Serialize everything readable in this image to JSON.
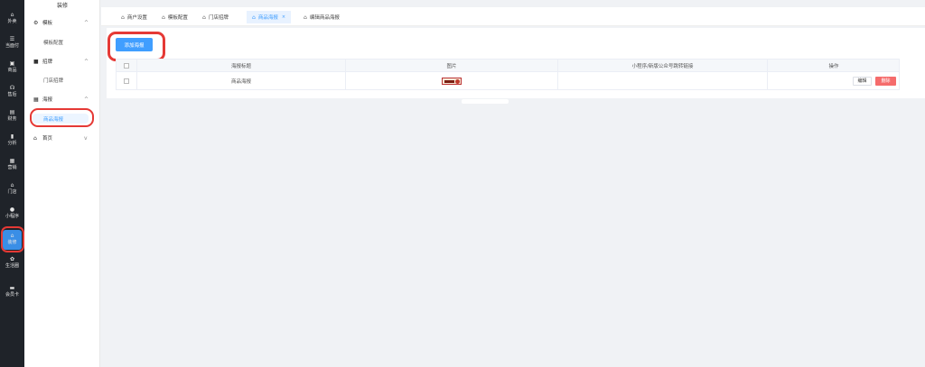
{
  "rail": {
    "items": [
      {
        "icon": "⌂",
        "label": "外卖"
      },
      {
        "icon": "☰",
        "label": "当面付"
      },
      {
        "icon": "▣",
        "label": "商品"
      },
      {
        "icon": "☊",
        "label": "售后"
      },
      {
        "icon": "▤",
        "label": "财务"
      },
      {
        "icon": "▮",
        "label": "分析"
      },
      {
        "icon": "▦",
        "label": "营销"
      },
      {
        "icon": "⌂",
        "label": "门店"
      },
      {
        "icon": "●",
        "label": "小程序"
      },
      {
        "icon": "⌂",
        "label": "装修"
      },
      {
        "icon": "✿",
        "label": "生活圈"
      },
      {
        "icon": "▬",
        "label": "会员卡"
      }
    ],
    "active_index": 9
  },
  "sidebar": {
    "title": "装修",
    "groups": [
      {
        "icon": "⚙",
        "label": "模板",
        "arrow": "^",
        "children": [
          "模板配置"
        ]
      },
      {
        "icon": "■",
        "label": "招牌",
        "arrow": "^",
        "children": [
          "门店招牌"
        ]
      },
      {
        "icon": "▦",
        "label": "海报",
        "arrow": "^",
        "children": [
          "商品海报"
        ]
      },
      {
        "icon": "⌂",
        "label": "首页",
        "arrow": "v",
        "children": []
      }
    ],
    "active_child": "商品海报"
  },
  "tabs": [
    {
      "label": "商户设置",
      "active": false
    },
    {
      "label": "模板配置",
      "active": false
    },
    {
      "label": "门店招牌",
      "active": false
    },
    {
      "label": "商品海报",
      "active": true,
      "close": "×"
    },
    {
      "label": "编辑商品海报",
      "active": false
    }
  ],
  "toolbar": {
    "add_label": "添加海报"
  },
  "table": {
    "columns": [
      "海报标题",
      "图片",
      "小程序/新版公众号跳转链接",
      "操作"
    ],
    "rows": [
      {
        "title": "商品海报",
        "image": "poster-thumbnail",
        "link": "",
        "actions": [
          "编辑",
          "删除"
        ]
      }
    ]
  },
  "colors": {
    "primary": "#409eff",
    "danger": "#f56c6c",
    "highlight_ring": "#e53935",
    "rail_bg": "#1f2329"
  }
}
